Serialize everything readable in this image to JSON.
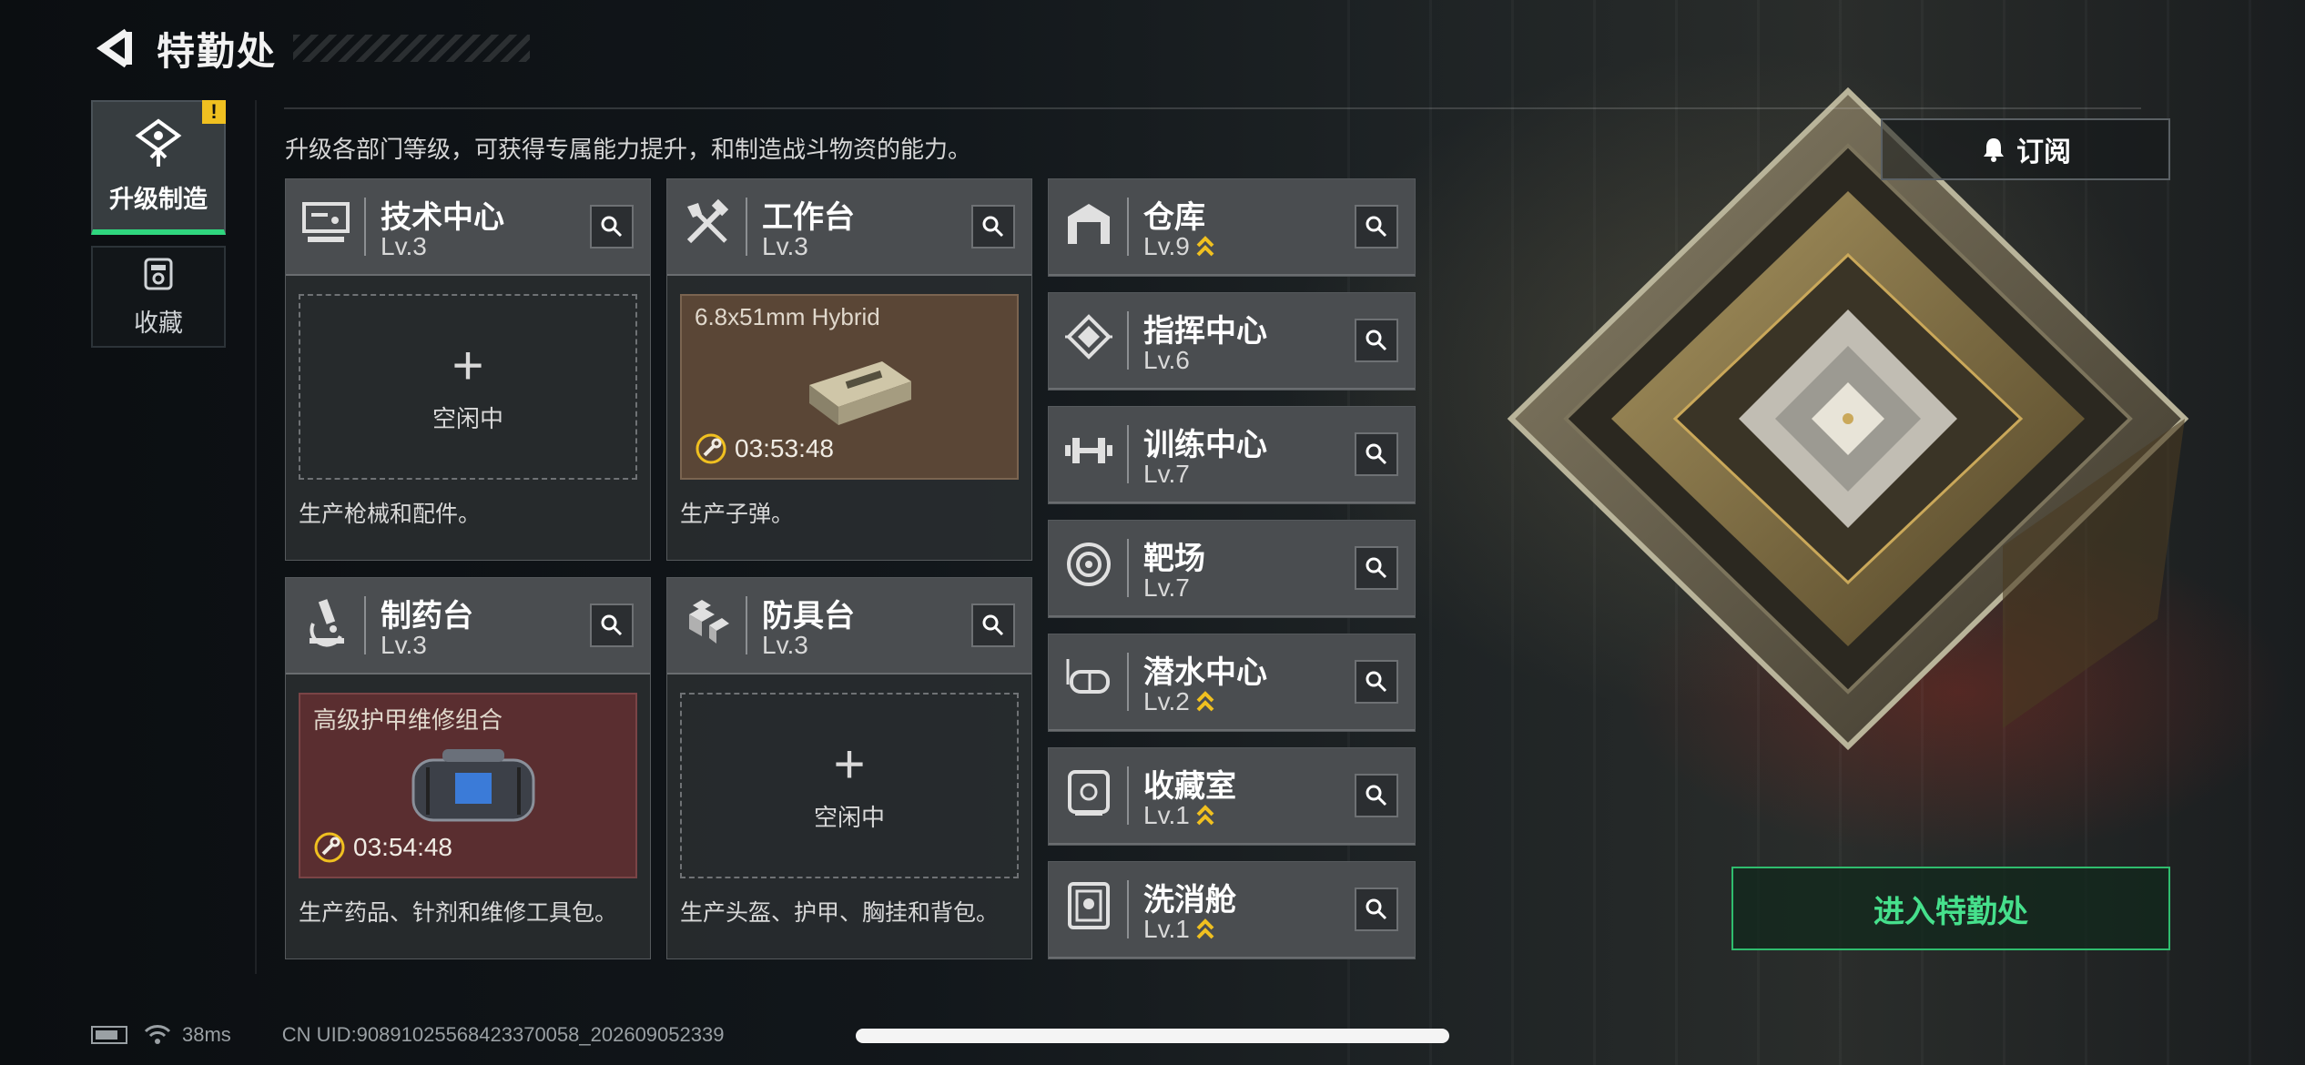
{
  "header": {
    "title": "特勤处"
  },
  "side_nav": {
    "items": [
      {
        "label": "升级制造",
        "active": true,
        "alert": "!"
      },
      {
        "label": "收藏",
        "active": false
      }
    ]
  },
  "description": "升级各部门等级，可获得专属能力提升，和制造战斗物资的能力。",
  "departments_large": [
    {
      "name": "技术中心",
      "level": "Lv.3",
      "icon": "tech-center-icon",
      "slot": {
        "state": "idle",
        "plus": "+",
        "status": "空闲中"
      },
      "footer": "生产枪械和配件。"
    },
    {
      "name": "工作台",
      "level": "Lv.3",
      "icon": "workbench-tools-icon",
      "slot": {
        "state": "producing",
        "item": "6.8x51mm Hybrid",
        "timer": "03:53:48",
        "item_icon": "ammo-box-icon"
      },
      "footer": "生产子弹。"
    },
    {
      "name": "制药台",
      "level": "Lv.3",
      "icon": "microscope-icon",
      "slot": {
        "state": "producing",
        "item": "高级护甲维修组合",
        "timer": "03:54:48",
        "item_icon": "repair-kit-bag-icon"
      },
      "footer": "生产药品、针剂和维修工具包。"
    },
    {
      "name": "防具台",
      "level": "Lv.3",
      "icon": "armor-bench-icon",
      "slot": {
        "state": "idle",
        "plus": "+",
        "status": "空闲中"
      },
      "footer": "生产头盔、护甲、胸挂和背包。"
    }
  ],
  "departments_small": [
    {
      "name": "仓库",
      "level": "Lv.9",
      "upgradable": true,
      "icon": "warehouse-icon"
    },
    {
      "name": "指挥中心",
      "level": "Lv.6",
      "upgradable": false,
      "icon": "command-chip-icon"
    },
    {
      "name": "训练中心",
      "level": "Lv.7",
      "upgradable": false,
      "icon": "dumbbell-icon"
    },
    {
      "name": "靶场",
      "level": "Lv.7",
      "upgradable": false,
      "icon": "target-icon"
    },
    {
      "name": "潜水中心",
      "level": "Lv.2",
      "upgradable": true,
      "icon": "diving-mask-icon"
    },
    {
      "name": "收藏室",
      "level": "Lv.1",
      "upgradable": true,
      "icon": "collection-room-icon"
    },
    {
      "name": "洗消舱",
      "level": "Lv.1",
      "upgradable": true,
      "icon": "decon-chamber-icon"
    }
  ],
  "buttons": {
    "subscribe": "订阅",
    "enter": "进入特勤处"
  },
  "status_bar": {
    "ping": "38ms",
    "uid": "CN UID:90891025568423370058_202609052339"
  },
  "colors": {
    "accent_green": "#2fd67e",
    "enter_green": "#46e08c",
    "upgrade_gold": "#f0c020",
    "brown_slot": "#5a4636",
    "red_slot": "#5a2e30"
  }
}
